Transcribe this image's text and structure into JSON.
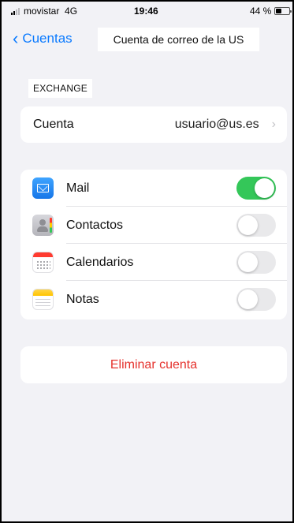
{
  "status_bar": {
    "carrier": "movistar",
    "network": "4G",
    "time": "19:46",
    "battery_percent": "44 %",
    "battery_level": 0.44
  },
  "nav": {
    "back_label": "Cuentas",
    "title": "Cuenta de correo de la US"
  },
  "section": {
    "header": "EXCHANGE"
  },
  "account": {
    "label": "Cuenta",
    "value": "usuario@us.es"
  },
  "services": [
    {
      "name": "Mail",
      "icon": "mail-icon",
      "enabled": true
    },
    {
      "name": "Contactos",
      "icon": "contacts-icon",
      "enabled": false
    },
    {
      "name": "Calendarios",
      "icon": "calendar-icon",
      "enabled": false
    },
    {
      "name": "Notas",
      "icon": "notes-icon",
      "enabled": false
    }
  ],
  "delete": {
    "label": "Eliminar cuenta"
  },
  "colors": {
    "accent": "#0a7aff",
    "toggle_on": "#34c759",
    "destructive": "#e5322d",
    "background": "#f2f2f6"
  }
}
